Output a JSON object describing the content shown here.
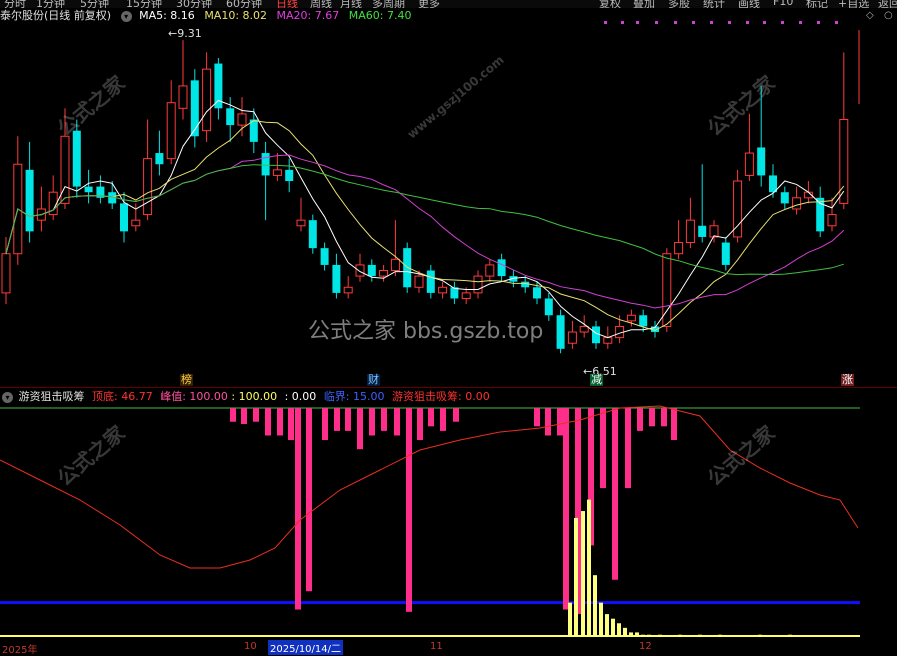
{
  "top_menu": {
    "items": [
      "分时",
      "1分钟",
      "5分钟",
      "15分钟",
      "30分钟",
      "60分钟",
      "日线",
      "周线",
      "月线",
      "多周期",
      "更多"
    ],
    "right_items": [
      "复权",
      "叠加",
      "多股",
      "统计",
      "画线",
      "F10",
      "标记",
      "+自选",
      "返回"
    ]
  },
  "chart_header": {
    "stock_name": "泰尔股份",
    "period": "(日线 前复权)",
    "ma5": "MA5: 8.16",
    "ma10": "MA10: 8.02",
    "ma20": "MA20: 7.67",
    "ma60": "MA60: 7.40"
  },
  "price_labels": {
    "high": "9.31",
    "low": "6.51"
  },
  "event_tags": [
    "榜",
    "财",
    "减",
    "涨"
  ],
  "watermarks": {
    "center": "公式之家 bbs.gszb.top",
    "corner": "公式之家",
    "corner_url": "www.gszj100.com"
  },
  "indicator_header": {
    "name": "游资狙击吸筹",
    "dingdi": "顶底: 46.77",
    "fengzhi": "峰值: 100.00",
    "v100": ": 100.00",
    "v0": ": 0.00",
    "linjie": "临界: 15.00",
    "xichou": "游资狙击吸筹: 0.00"
  },
  "time_axis": {
    "year": "2025年",
    "m10": "10",
    "date": "2025/10/14/二",
    "m11": "11",
    "m12": "12"
  },
  "colors": {
    "up": "#ff3a3a",
    "down": "#00e5e5",
    "ma5": "#ffffff",
    "ma10": "#e8e070",
    "ma20": "#d040d0",
    "ma60": "#40c040",
    "bar_pink": "#ff2e8a",
    "bar_yellow": "#ffff80",
    "line_red": "#e83020",
    "blue_line": "#1010ff"
  },
  "chart_data": {
    "type": "candlestick",
    "ma_values": {
      "MA5": 8.16,
      "MA10": 8.02,
      "MA20": 7.67,
      "MA60": 7.4
    },
    "labeled_high": 9.31,
    "labeled_low": 6.51,
    "candles": [
      {
        "o": 7.05,
        "c": 7.4,
        "h": 7.55,
        "l": 6.95
      },
      {
        "o": 7.4,
        "c": 8.2,
        "h": 8.45,
        "l": 7.3
      },
      {
        "o": 8.15,
        "c": 7.6,
        "h": 8.4,
        "l": 7.5
      },
      {
        "o": 7.7,
        "c": 7.8,
        "h": 8.0,
        "l": 7.6
      },
      {
        "o": 7.75,
        "c": 7.95,
        "h": 8.1,
        "l": 7.7
      },
      {
        "o": 7.85,
        "c": 8.45,
        "h": 8.7,
        "l": 7.8
      },
      {
        "o": 8.5,
        "c": 8.0,
        "h": 8.6,
        "l": 7.9
      },
      {
        "o": 8.0,
        "c": 7.95,
        "h": 8.15,
        "l": 7.85
      },
      {
        "o": 8.0,
        "c": 7.9,
        "h": 8.1,
        "l": 7.85
      },
      {
        "o": 7.95,
        "c": 7.85,
        "h": 8.05,
        "l": 7.8
      },
      {
        "o": 7.85,
        "c": 7.6,
        "h": 7.95,
        "l": 7.5
      },
      {
        "o": 7.65,
        "c": 7.7,
        "h": 7.85,
        "l": 7.6
      },
      {
        "o": 7.75,
        "c": 8.25,
        "h": 8.6,
        "l": 7.7
      },
      {
        "o": 8.3,
        "c": 8.2,
        "h": 8.5,
        "l": 8.1
      },
      {
        "o": 8.25,
        "c": 8.75,
        "h": 8.95,
        "l": 8.2
      },
      {
        "o": 8.7,
        "c": 8.9,
        "h": 9.31,
        "l": 8.6
      },
      {
        "o": 8.95,
        "c": 8.45,
        "h": 9.05,
        "l": 8.35
      },
      {
        "o": 8.5,
        "c": 9.05,
        "h": 9.2,
        "l": 8.4
      },
      {
        "o": 9.1,
        "c": 8.7,
        "h": 9.15,
        "l": 8.6
      },
      {
        "o": 8.7,
        "c": 8.55,
        "h": 8.8,
        "l": 8.4
      },
      {
        "o": 8.55,
        "c": 8.65,
        "h": 8.8,
        "l": 8.45
      },
      {
        "o": 8.6,
        "c": 8.4,
        "h": 8.7,
        "l": 8.3
      },
      {
        "o": 8.3,
        "c": 8.1,
        "h": 8.4,
        "l": 7.7
      },
      {
        "o": 8.1,
        "c": 8.15,
        "h": 8.3,
        "l": 8.05
      },
      {
        "o": 8.15,
        "c": 8.05,
        "h": 8.25,
        "l": 7.95
      },
      {
        "o": 7.65,
        "c": 7.7,
        "h": 7.9,
        "l": 7.6
      },
      {
        "o": 7.7,
        "c": 7.45,
        "h": 7.75,
        "l": 7.4
      },
      {
        "o": 7.45,
        "c": 7.3,
        "h": 7.5,
        "l": 7.25
      },
      {
        "o": 7.3,
        "c": 7.05,
        "h": 7.4,
        "l": 7.0
      },
      {
        "o": 7.05,
        "c": 7.1,
        "h": 7.2,
        "l": 7.0
      },
      {
        "o": 7.2,
        "c": 7.3,
        "h": 7.4,
        "l": 7.15
      },
      {
        "o": 7.3,
        "c": 7.2,
        "h": 7.35,
        "l": 7.15
      },
      {
        "o": 7.2,
        "c": 7.25,
        "h": 7.3,
        "l": 7.15
      },
      {
        "o": 7.25,
        "c": 7.35,
        "h": 7.7,
        "l": 7.2
      },
      {
        "o": 7.45,
        "c": 7.1,
        "h": 7.5,
        "l": 7.05
      },
      {
        "o": 7.1,
        "c": 7.2,
        "h": 7.25,
        "l": 7.05
      },
      {
        "o": 7.25,
        "c": 7.05,
        "h": 7.3,
        "l": 7.0
      },
      {
        "o": 7.05,
        "c": 7.1,
        "h": 7.15,
        "l": 7.0
      },
      {
        "o": 7.1,
        "c": 7.0,
        "h": 7.15,
        "l": 6.95
      },
      {
        "o": 7.0,
        "c": 7.05,
        "h": 7.1,
        "l": 6.95
      },
      {
        "o": 7.05,
        "c": 7.2,
        "h": 7.25,
        "l": 7.0
      },
      {
        "o": 7.2,
        "c": 7.3,
        "h": 7.35,
        "l": 7.15
      },
      {
        "o": 7.35,
        "c": 7.2,
        "h": 7.4,
        "l": 7.15
      },
      {
        "o": 7.2,
        "c": 7.15,
        "h": 7.25,
        "l": 7.1
      },
      {
        "o": 7.15,
        "c": 7.1,
        "h": 7.2,
        "l": 7.05
      },
      {
        "o": 7.1,
        "c": 7.0,
        "h": 7.15,
        "l": 6.95
      },
      {
        "o": 7.0,
        "c": 6.85,
        "h": 7.05,
        "l": 6.8
      },
      {
        "o": 6.85,
        "c": 6.55,
        "h": 6.9,
        "l": 6.51
      },
      {
        "o": 6.6,
        "c": 6.7,
        "h": 6.8,
        "l": 6.55
      },
      {
        "o": 6.7,
        "c": 6.75,
        "h": 6.85,
        "l": 6.65
      },
      {
        "o": 6.75,
        "c": 6.6,
        "h": 6.8,
        "l": 6.55
      },
      {
        "o": 6.6,
        "c": 6.65,
        "h": 6.75,
        "l": 6.55
      },
      {
        "o": 6.65,
        "c": 6.75,
        "h": 6.85,
        "l": 6.6
      },
      {
        "o": 6.8,
        "c": 6.85,
        "h": 6.9,
        "l": 6.75
      },
      {
        "o": 6.85,
        "c": 6.75,
        "h": 6.9,
        "l": 6.7
      },
      {
        "o": 6.75,
        "c": 6.7,
        "h": 6.8,
        "l": 6.65
      },
      {
        "o": 6.75,
        "c": 7.4,
        "h": 7.45,
        "l": 6.7
      },
      {
        "o": 7.4,
        "c": 7.5,
        "h": 7.7,
        "l": 7.35
      },
      {
        "o": 7.5,
        "c": 7.7,
        "h": 7.9,
        "l": 7.45
      },
      {
        "o": 7.65,
        "c": 7.55,
        "h": 8.2,
        "l": 7.5
      },
      {
        "o": 7.55,
        "c": 7.65,
        "h": 7.7,
        "l": 7.5
      },
      {
        "o": 7.5,
        "c": 7.3,
        "h": 7.55,
        "l": 7.25
      },
      {
        "o": 7.55,
        "c": 8.05,
        "h": 8.15,
        "l": 7.5
      },
      {
        "o": 8.1,
        "c": 8.3,
        "h": 8.65,
        "l": 8.05
      },
      {
        "o": 8.35,
        "c": 8.1,
        "h": 8.9,
        "l": 8.0
      },
      {
        "o": 8.1,
        "c": 7.95,
        "h": 8.2,
        "l": 7.9
      },
      {
        "o": 7.95,
        "c": 7.85,
        "h": 8.0,
        "l": 7.8
      },
      {
        "o": 7.8,
        "c": 7.9,
        "h": 8.0,
        "l": 7.75
      },
      {
        "o": 7.9,
        "c": 7.95,
        "h": 8.05,
        "l": 7.85
      },
      {
        "o": 7.9,
        "c": 7.6,
        "h": 8.0,
        "l": 7.55
      },
      {
        "o": 7.65,
        "c": 7.75,
        "h": 7.9,
        "l": 7.6
      },
      {
        "o": 7.85,
        "c": 8.6,
        "h": 9.2,
        "l": 7.8
      }
    ],
    "indicator": {
      "dingdi": 46.77,
      "fengzhi": 100.0,
      "linjie": 15.0,
      "xichou": 0.0
    }
  }
}
